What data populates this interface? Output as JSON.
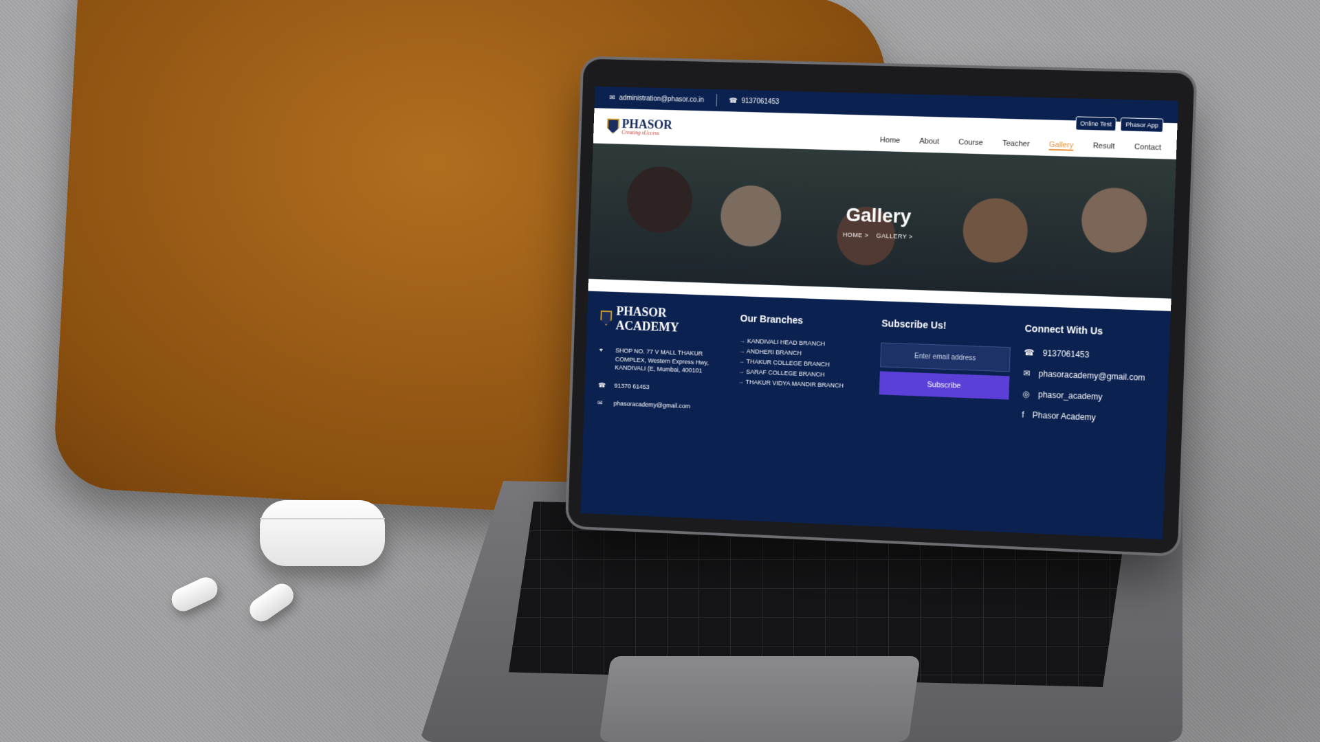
{
  "topbar": {
    "email": "administration@phasor.co.in",
    "phone": "9137061453"
  },
  "logo": {
    "name": "PHASOR",
    "tagline": "Creating sUccess"
  },
  "top_buttons": [
    "Online Test",
    "Phasor App"
  ],
  "nav": [
    "Home",
    "About",
    "Course",
    "Teacher",
    "Gallery",
    "Result",
    "Contact"
  ],
  "nav_active": "Gallery",
  "hero": {
    "title": "Gallery",
    "breadcrumb": [
      "HOME >",
      "GALLERY >"
    ]
  },
  "footer": {
    "brand": "PHASOR ACADEMY",
    "address": "SHOP NO. 77 V MALL THAKUR COMPLEX, Western Express Hwy, KANDIVALI (E, Mumbai, 400101",
    "phone": "91370 61453",
    "email": "phasoracademy@gmail.com",
    "branches_title": "Our Branches",
    "branches": [
      "KANDIVALI HEAD BRANCH",
      "ANDHERI BRANCH",
      "THAKUR COLLEGE BRANCH",
      "SARAF COLLEGE BRANCH",
      "THAKUR VIDYA MANDIR BRANCH"
    ],
    "subscribe_title": "Subscribe Us!",
    "subscribe_placeholder": "Enter email address",
    "subscribe_button": "Subscribe",
    "connect_title": "Connect With Us",
    "connect": {
      "phone": "9137061453",
      "email": "phasoracademy@gmail.com",
      "instagram": "phasor_academy",
      "facebook": "Phasor Academy"
    }
  },
  "icons": {
    "mail": "mail-icon",
    "phone": "phone-icon",
    "location": "location-icon",
    "instagram": "instagram-icon",
    "facebook": "facebook-icon"
  },
  "colors": {
    "navy": "#0b2150",
    "accent": "#e8903a",
    "subscribe": "#5b3fd6"
  }
}
